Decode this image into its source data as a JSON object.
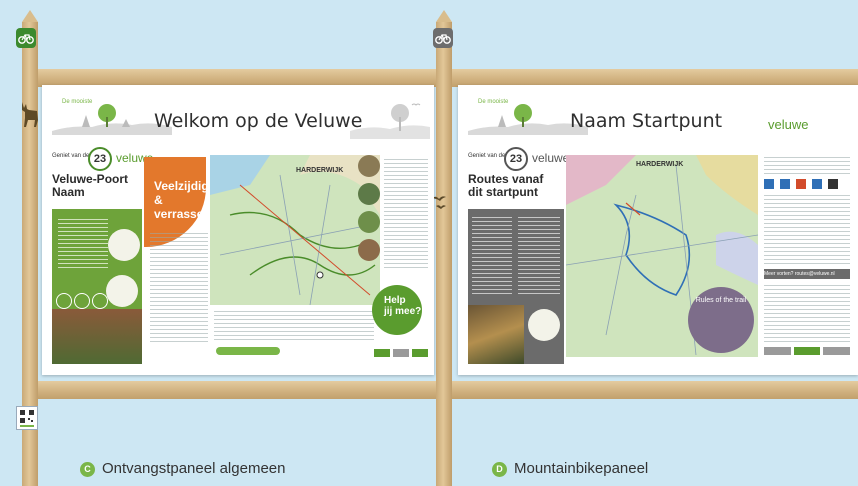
{
  "panels": [
    {
      "title": "Welkom op de Veluwe",
      "geniet": "Geniet van de",
      "number": "23",
      "brand": "veluwe",
      "subtitle_line1": "Veluwe-Poort",
      "subtitle_line2": "Naam",
      "callout_line1": "Veelzijdig &",
      "callout_line2": "verrassend",
      "map_label": "HARDERWIJK",
      "help_line1": "Help",
      "help_line2": "jij mee?"
    },
    {
      "title": "Naam Startpunt",
      "geniet": "Geniet van de",
      "number": "23",
      "brand": "veluwe",
      "subtitle_line1": "Routes vanaf",
      "subtitle_line2": "dit startpunt",
      "map_label": "HARDERWIJK",
      "logo_text": "veluwe",
      "rules_label": "Rules of the trail",
      "contact": "Meer vorten? routes@veluwe.nl"
    }
  ],
  "captions": [
    {
      "letter": "C",
      "text": "Ontvangstpaneel algemeen",
      "color": "#7ab648"
    },
    {
      "letter": "D",
      "text": "Mountainbikepaneel",
      "color": "#7ab648"
    }
  ],
  "icons": {
    "post1_badge": "bike-icon",
    "post2_badge": "bike-icon",
    "deer": "deer-icon",
    "qr": "qr-code-icon"
  },
  "colors": {
    "green": "#5a9c2e",
    "orange": "#e3782c",
    "badge_green": "#3c8a2e",
    "badge_grey": "#6d6d6d"
  }
}
